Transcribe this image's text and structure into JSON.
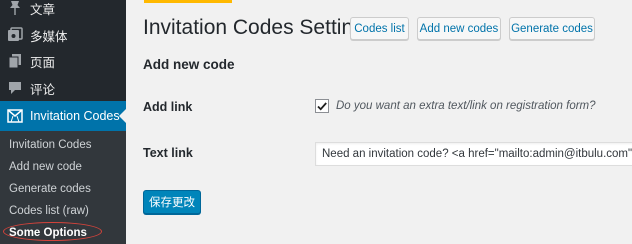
{
  "sidebar": {
    "menu": [
      {
        "label": "文章",
        "icon": "pin-icon"
      },
      {
        "label": "多媒体",
        "icon": "media-icon"
      },
      {
        "label": "页面",
        "icon": "page-icon"
      },
      {
        "label": "评论",
        "icon": "comment-icon"
      }
    ],
    "current": {
      "label": "Invitation Codes",
      "icon": "invitation-codes-icon"
    },
    "submenu": [
      "Invitation Codes",
      "Add new code",
      "Generate codes",
      "Codes list (raw)",
      "Some Options"
    ]
  },
  "header": {
    "title": "Invitation Codes Settings",
    "buttons": [
      "Codes list",
      "Add new codes",
      "Generate codes"
    ]
  },
  "form": {
    "section_title": "Add new code",
    "add_link": {
      "label": "Add link",
      "checked": true,
      "description": "Do you want an extra text/link on registration form?"
    },
    "text_link": {
      "label": "Text link",
      "value": "Need an invitation code? <a href=\"mailto:admin@itbulu.com\">Contact us</a>"
    },
    "submit_label": "保存更改"
  },
  "colors": {
    "sidebar_bg": "#23282d",
    "submenu_bg": "#32373c",
    "accent": "#0073aa",
    "primary_button": "#0085ba",
    "annotation": "#d4433b",
    "notice": "#ffb900"
  }
}
